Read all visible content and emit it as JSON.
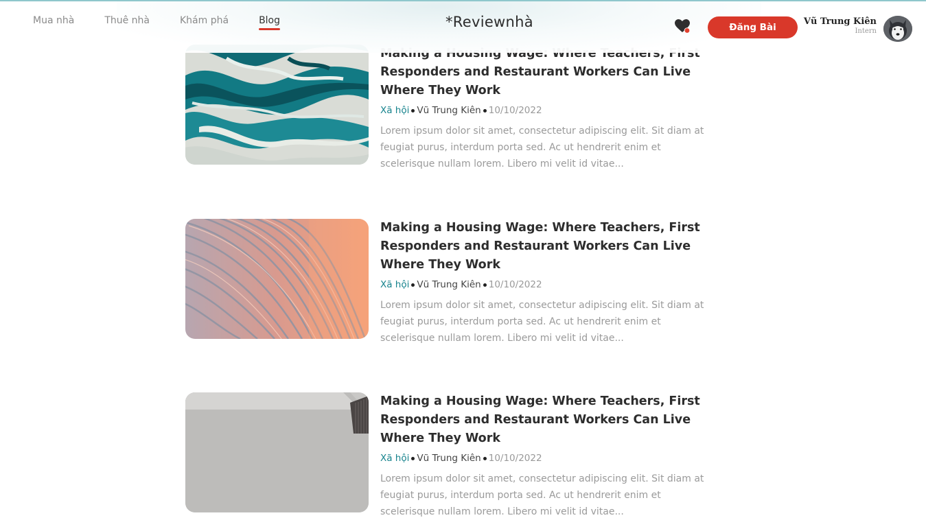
{
  "header": {
    "nav": [
      "Mua nhà",
      "Thuê nhà",
      "Khám phá",
      "Blog"
    ],
    "active_nav": "Blog",
    "logo": "*Reviewnhà",
    "post_button": "Đăng Bài",
    "user": {
      "name": "Vũ Trung Kiên",
      "role": "Intern"
    }
  },
  "posts": [
    {
      "title": "Making a Housing Wage: Where Teachers, First Responders and Restaurant Workers Can Live Where They Work",
      "category": "Xã hội",
      "author": "Vũ Trung Kiên",
      "date": "10/10/2022",
      "excerpt": "Lorem ipsum dolor sit amet, consectetur adipiscing elit. Sit diam at feugiat purus, interdum porta sed. Ac ut hendrerit enim et scelerisque nullam lorem. Libero mi velit id vitae...",
      "image": "teal-marble"
    },
    {
      "title": "Making a Housing Wage: Where Teachers, First Responders and Restaurant Workers Can Live Where They Work",
      "category": "Xã hội",
      "author": "Vũ Trung Kiên",
      "date": "10/10/2022",
      "excerpt": "Lorem ipsum dolor sit amet, consectetur adipiscing elit. Sit diam at feugiat purus, interdum porta sed. Ac ut hendrerit enim et scelerisque nullam lorem. Libero mi velit id vitae...",
      "image": "coral-waves"
    },
    {
      "title": "Making a Housing Wage: Where Teachers, First Responders and Restaurant Workers Can Live Where They Work",
      "category": "Xã hội",
      "author": "Vũ Trung Kiên",
      "date": "10/10/2022",
      "excerpt": "Lorem ipsum dolor sit amet, consectetur adipiscing elit. Sit diam at feugiat purus, interdum porta sed. Ac ut hendrerit enim et scelerisque nullam lorem. Libero mi velit id vitae...",
      "image": "grey-concrete"
    }
  ],
  "colors": {
    "accent": "#d9382a",
    "category": "#17838d",
    "notification_dot": "#e0412f"
  }
}
